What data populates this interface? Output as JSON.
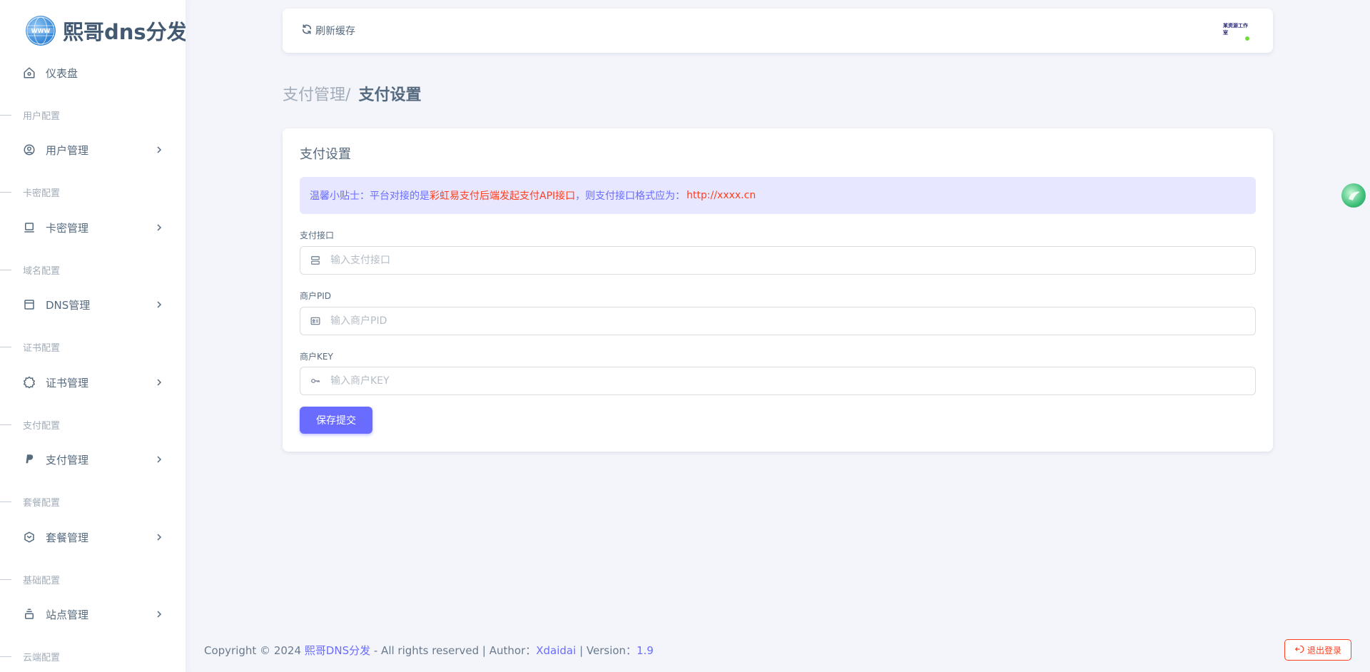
{
  "brand": {
    "name": "熙哥dns分发",
    "logo_icon": "www-globe-icon"
  },
  "sidebar": {
    "dashboard": {
      "label": "仪表盘",
      "icon": "home-icon"
    },
    "sections": [
      {
        "header": "用户配置",
        "item": "用户管理",
        "icon": "user-circle-icon"
      },
      {
        "header": "卡密配置",
        "item": "卡密管理",
        "icon": "laptop-icon"
      },
      {
        "header": "域名配置",
        "item": "DNS管理",
        "icon": "window-icon"
      },
      {
        "header": "证书配置",
        "item": "证书管理",
        "icon": "badge-icon"
      },
      {
        "header": "支付配置",
        "item": "支付管理",
        "icon": "paypal-icon"
      },
      {
        "header": "套餐配置",
        "item": "套餐管理",
        "icon": "package-icon"
      },
      {
        "header": "基础配置",
        "item": "站点管理",
        "icon": "stack-icon"
      },
      {
        "header": "云端配置"
      }
    ]
  },
  "topbar": {
    "refresh_label": "刷新缓存",
    "avatar_text": "某资源工作室"
  },
  "breadcrumb": {
    "parent": "支付管理",
    "separator": "/",
    "current": "支付设置"
  },
  "card": {
    "title": "支付设置",
    "alert": {
      "lead": "温馨小贴士：平台对接的是",
      "highlight": "彩虹易支付后端发起支付API接口",
      "tail": "，则支付接口格式应为：",
      "url": "http://xxxx.cn"
    },
    "fields": [
      {
        "label": "支付接口",
        "placeholder": "输入支付接口",
        "value": "",
        "icon": "server-icon"
      },
      {
        "label": "商户PID",
        "placeholder": "输入商户PID",
        "value": "",
        "icon": "id-card-icon"
      },
      {
        "label": "商户KEY",
        "placeholder": "输入商户KEY",
        "value": "",
        "icon": "key-icon"
      }
    ],
    "submit_label": "保存提交"
  },
  "footer": {
    "prefix": "Copyright © 2024",
    "site_link": "熙哥DNS分发",
    "rights": "- All rights reserved | Author：",
    "author": "Xdaidai",
    "version_label": "| Version：",
    "version": "1.9"
  },
  "logout_label": "退出登录",
  "colors": {
    "primary": "#696cff",
    "danger": "#ff3e1d",
    "success": "#71dd37",
    "text": "#566a7f",
    "muted": "#a1acb8"
  }
}
